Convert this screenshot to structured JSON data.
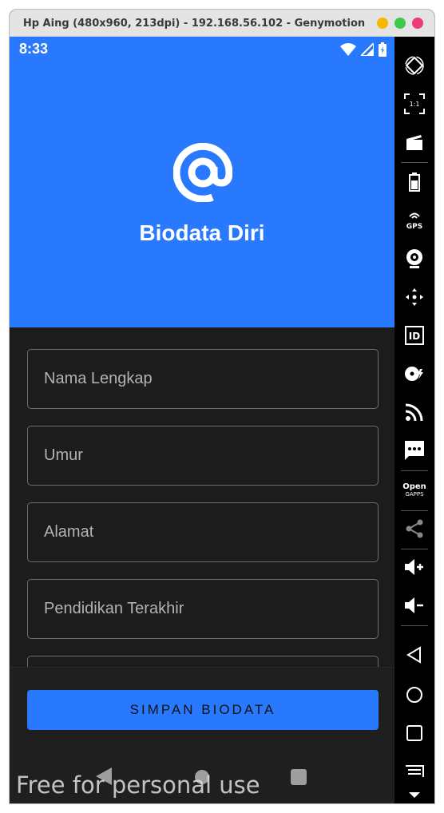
{
  "window": {
    "title": "Hp Aing (480x960, 213dpi) - 192.168.56.102 - Genymotion"
  },
  "status_bar": {
    "time": "8:33"
  },
  "app": {
    "title": "Biodata Diri",
    "fields": [
      {
        "placeholder": "Nama Lengkap",
        "value": ""
      },
      {
        "placeholder": "Umur",
        "value": ""
      },
      {
        "placeholder": "Alamat",
        "value": ""
      },
      {
        "placeholder": "Pendidikan Terakhir",
        "value": ""
      }
    ],
    "save_button": "SIMPAN BIODATA"
  },
  "toolbar": {
    "open_gapps_line1": "Open",
    "open_gapps_line2": "GAPPS"
  },
  "watermark": "Free for personal use",
  "colors": {
    "accent": "#2979ff",
    "background": "#1c1c1c",
    "toolbar": "#000000"
  }
}
